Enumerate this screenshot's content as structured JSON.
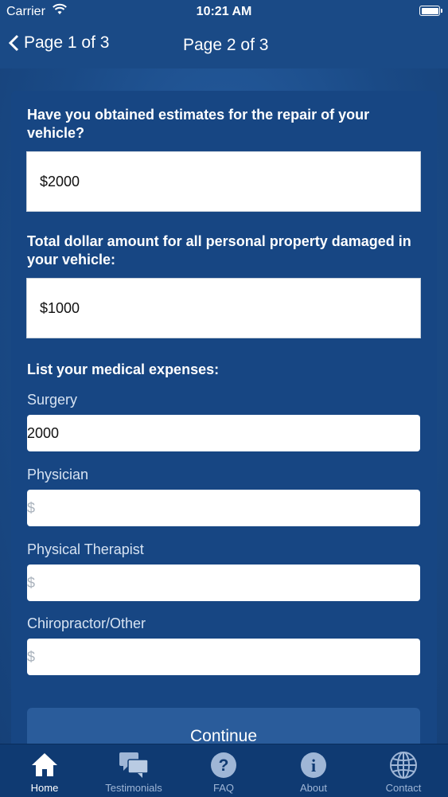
{
  "status_bar": {
    "carrier": "Carrier",
    "time": "10:21 AM"
  },
  "nav": {
    "back_label": "Page 1 of 3",
    "title": "Page 2 of 3"
  },
  "form": {
    "repair_question": "Have you obtained estimates for the repair of your vehicle?",
    "repair_value": "$2000",
    "property_question": "Total dollar amount for all personal property damaged in your vehicle:",
    "property_value": "$1000",
    "medical_heading": "List your medical expenses:",
    "surgery_label": "Surgery",
    "surgery_value": "2000",
    "physician_label": "Physician",
    "physician_placeholder": "$",
    "therapist_label": "Physical Therapist",
    "therapist_placeholder": "$",
    "chiro_label": "Chiropractor/Other",
    "chiro_placeholder": "$",
    "continue_label": "Continue"
  },
  "tabs": [
    {
      "label": "Home",
      "icon": "home-icon",
      "active": true
    },
    {
      "label": "Testimonials",
      "icon": "chat-bubbles-icon",
      "active": false
    },
    {
      "label": "FAQ",
      "icon": "question-icon",
      "active": false
    },
    {
      "label": "About",
      "icon": "info-icon",
      "active": false
    },
    {
      "label": "Contact",
      "icon": "globe-icon",
      "active": false
    }
  ],
  "colors": {
    "background": "#1c4f8c",
    "card": "#174683",
    "tabbar": "#0f3a72",
    "button": "#2a5c9b"
  }
}
